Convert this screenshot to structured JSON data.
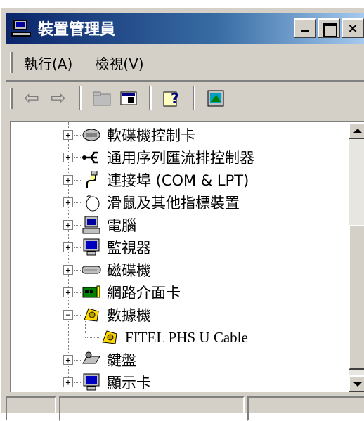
{
  "window": {
    "title": "裝置管理員",
    "controls": {
      "minimize": "_",
      "maximize": "□",
      "close": "×"
    }
  },
  "menu": {
    "items": [
      {
        "label": "執行(A)"
      },
      {
        "label": "檢視(V)"
      }
    ]
  },
  "toolbar": {
    "back": "⇦",
    "forward": "⇨",
    "properties": "▤",
    "help": "?"
  },
  "tree": {
    "items": [
      {
        "label": "軟碟機控制卡",
        "icon": "floppy-controller-icon",
        "expander": "+"
      },
      {
        "label": "通用序列匯流排控制器",
        "icon": "usb-icon",
        "expander": "+"
      },
      {
        "label": "連接埠 (COM & LPT)",
        "icon": "port-icon",
        "expander": "+"
      },
      {
        "label": "滑鼠及其他指標裝置",
        "icon": "mouse-icon",
        "expander": "+"
      },
      {
        "label": "電腦",
        "icon": "computer-icon",
        "expander": "+"
      },
      {
        "label": "監視器",
        "icon": "monitor-icon",
        "expander": "+"
      },
      {
        "label": "磁碟機",
        "icon": "disk-drive-icon",
        "expander": "+"
      },
      {
        "label": "網路介面卡",
        "icon": "network-adapter-icon",
        "expander": "+"
      },
      {
        "label": "數據機",
        "icon": "modem-icon",
        "expander": "−"
      },
      {
        "label": "FITEL PHS U Cable",
        "icon": "modem-icon",
        "expander": ""
      },
      {
        "label": "鍵盤",
        "icon": "keyboard-icon",
        "expander": "+"
      },
      {
        "label": "顯示卡",
        "icon": "display-adapter-icon",
        "expander": "+"
      }
    ]
  },
  "colors": {
    "titlebar_start": "#0a246a",
    "titlebar_end": "#a6caf0",
    "face": "#d4d0c8"
  }
}
